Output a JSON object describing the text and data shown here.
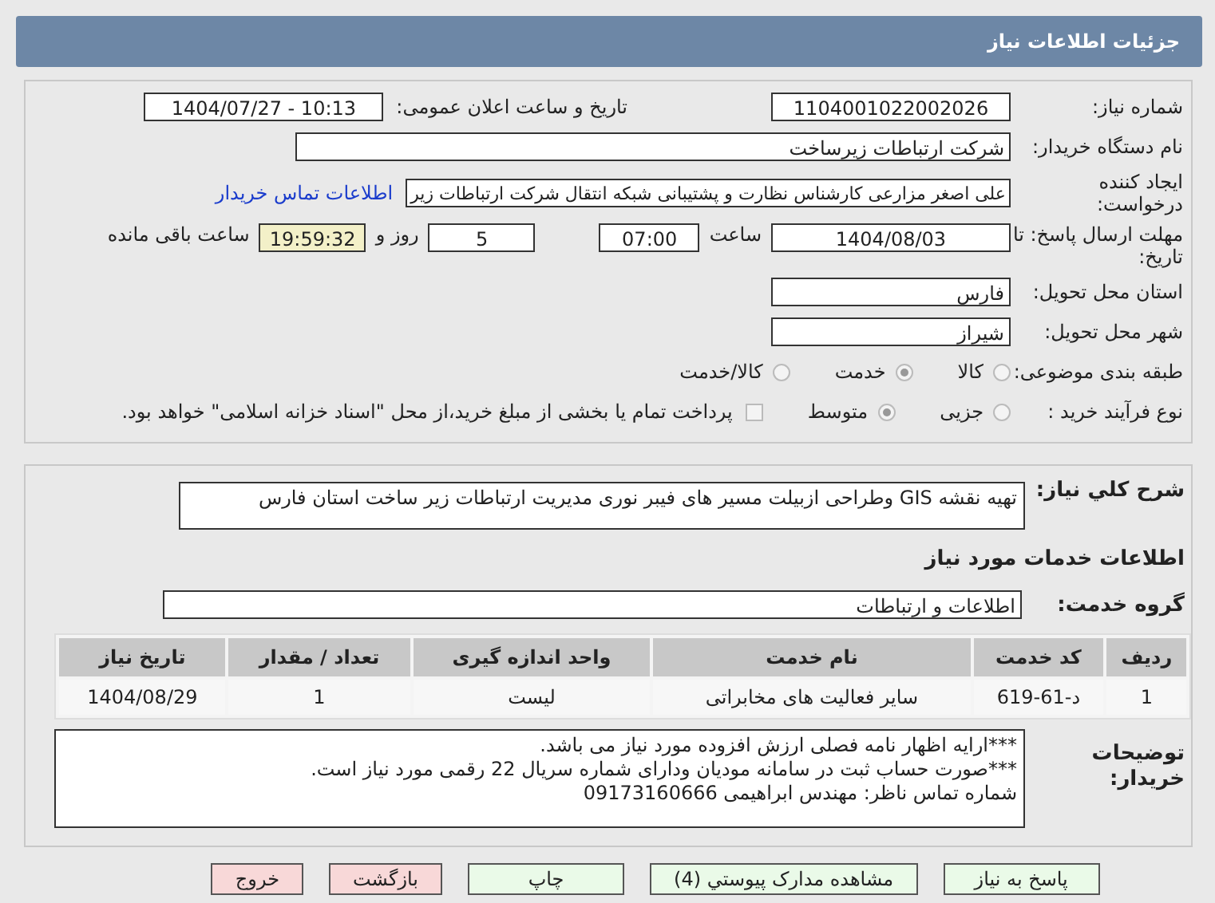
{
  "header": {
    "title": "جزئیات اطلاعات نیاز"
  },
  "need_number": {
    "label": "شماره نیاز:",
    "value": "1104001022002026"
  },
  "announce": {
    "label": "تاریخ و ساعت اعلان عمومی:",
    "value": "1404/07/27 - 10:13"
  },
  "buyer": {
    "label": "نام دستگاه خریدار:",
    "value": "شرکت ارتباطات زیرساخت"
  },
  "creator": {
    "label": "ایجاد کننده درخواست:",
    "value": "علی اصغر مزارعی کارشناس نظارت و پشتیبانی شبکه انتقال شرکت ارتباطات زیر",
    "link": "اطلاعات تماس خریدار"
  },
  "deadline": {
    "label": "مهلت ارسال پاسخ: تا تاریخ:",
    "date": "1404/08/03",
    "time_label": "ساعت",
    "time": "07:00",
    "days": "5",
    "days_label": "روز و",
    "remaining": "19:59:32",
    "remaining_label": "ساعت باقی مانده"
  },
  "province": {
    "label": "استان محل تحویل:",
    "value": "فارس"
  },
  "city": {
    "label": "شهر محل تحویل:",
    "value": "شیراز"
  },
  "category": {
    "label": "طبقه بندی موضوعی:",
    "options": [
      {
        "label": "کالا",
        "selected": false
      },
      {
        "label": "خدمت",
        "selected": true
      },
      {
        "label": "کالا/خدمت",
        "selected": false
      }
    ]
  },
  "process": {
    "label": "نوع فرآیند خرید :",
    "options": [
      {
        "label": "جزیی",
        "selected": false
      },
      {
        "label": "متوسط",
        "selected": true
      }
    ],
    "payment": {
      "label": "پرداخت تمام یا بخشی از مبلغ خرید،از محل \"اسناد خزانه اسلامی\" خواهد بود.",
      "checked": false
    }
  },
  "description": {
    "label": "شرح کلي نياز:",
    "value": "تهیه نقشه GIS وطراحی ازبیلت مسیر های فیبر نوری مدیریت ارتباطات زیر ساخت استان فارس"
  },
  "services_heading": "اطلاعات خدمات مورد نیاز",
  "service_group": {
    "label": "گروه خدمت:",
    "value": "اطلاعات و ارتباطات"
  },
  "table": {
    "columns": [
      "ردیف",
      "کد خدمت",
      "نام خدمت",
      "واحد اندازه گیری",
      "تعداد / مقدار",
      "تاریخ نیاز"
    ],
    "rows": [
      [
        "1",
        "د-61-619",
        "سایر فعالیت های مخابراتی",
        "لیست",
        "1",
        "1404/08/29"
      ]
    ]
  },
  "notes": {
    "label": "توضیحات خریدار:",
    "lines": [
      "***ارایه اظهار نامه فصلی ارزش افزوده مورد نیاز می باشد.",
      "***صورت حساب ثبت در سامانه مودیان ودارای شماره سریال 22 رقمی مورد نیاز است.",
      "شماره تماس ناظر: مهندس ابراهیمی 09173160666"
    ]
  },
  "buttons": [
    {
      "label": "پاسخ به نیاز",
      "kind": "green"
    },
    {
      "label": "مشاهده مدارک پیوستي (4)",
      "kind": "green"
    },
    {
      "label": "چاپ",
      "kind": "green"
    },
    {
      "label": "بازگشت",
      "kind": "red"
    },
    {
      "label": "خروج",
      "kind": "red"
    }
  ]
}
